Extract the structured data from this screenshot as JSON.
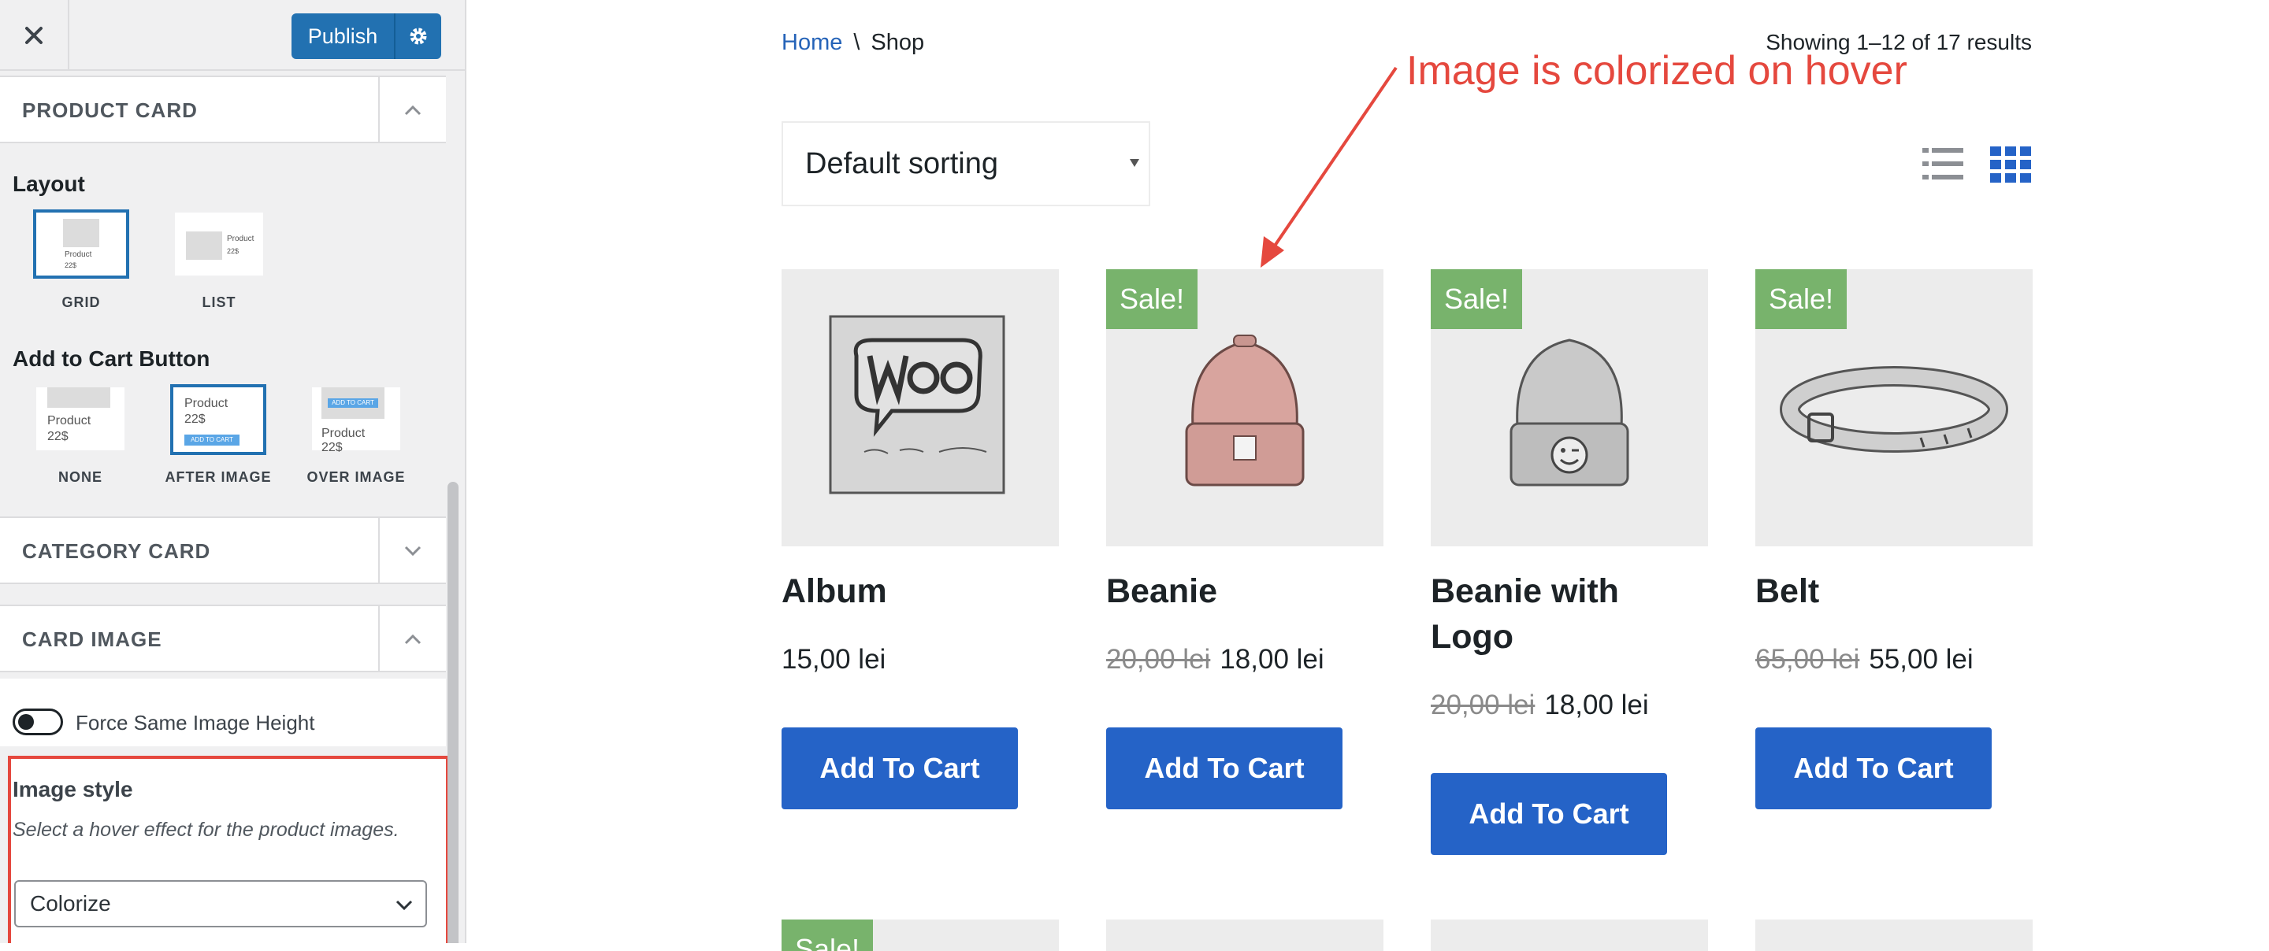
{
  "sidebar": {
    "publish_label": "Publish",
    "sections": {
      "product_card": "PRODUCT CARD",
      "category_card": "CATEGORY CARD",
      "card_image": "CARD IMAGE"
    },
    "layout": {
      "label": "Layout",
      "options": [
        "GRID",
        "LIST"
      ],
      "selected": "GRID"
    },
    "add_to_cart": {
      "label": "Add to Cart Button",
      "options": [
        "NONE",
        "AFTER IMAGE",
        "OVER IMAGE"
      ],
      "selected": "AFTER IMAGE"
    },
    "thumb_text": {
      "product": "Product",
      "price": "22$",
      "add_btn": "ADD TO CART"
    },
    "force_height": {
      "label": "Force Same Image Height",
      "enabled": false
    },
    "image_style": {
      "title": "Image style",
      "description": "Select a hover effect for the product images.",
      "value": "Colorize"
    }
  },
  "shop": {
    "breadcrumb": {
      "home": "Home",
      "separator": "\\",
      "current": "Shop"
    },
    "result_count": "Showing 1–12 of 17 results",
    "sorting": "Default sorting",
    "annotation": "Image is colorized on hover",
    "sale_badge": "Sale!",
    "cart_label": "Add To Cart",
    "products": [
      {
        "name": "Album",
        "old_price": "",
        "price": "15,00 lei",
        "sale": false,
        "image": "woo-album-icon"
      },
      {
        "name": "Beanie",
        "old_price": "20,00 lei",
        "price": "18,00 lei",
        "sale": true,
        "image": "beanie-icon"
      },
      {
        "name": "Beanie with Logo",
        "old_price": "20,00 lei",
        "price": "18,00 lei",
        "sale": true,
        "image": "beanie-logo-icon"
      },
      {
        "name": "Belt",
        "old_price": "65,00 lei",
        "price": "55,00 lei",
        "sale": true,
        "image": "belt-icon"
      }
    ]
  },
  "colors": {
    "accent": "#2563c7",
    "publish": "#2271b1",
    "sale": "#78b36c",
    "annotation": "#e5483e"
  }
}
